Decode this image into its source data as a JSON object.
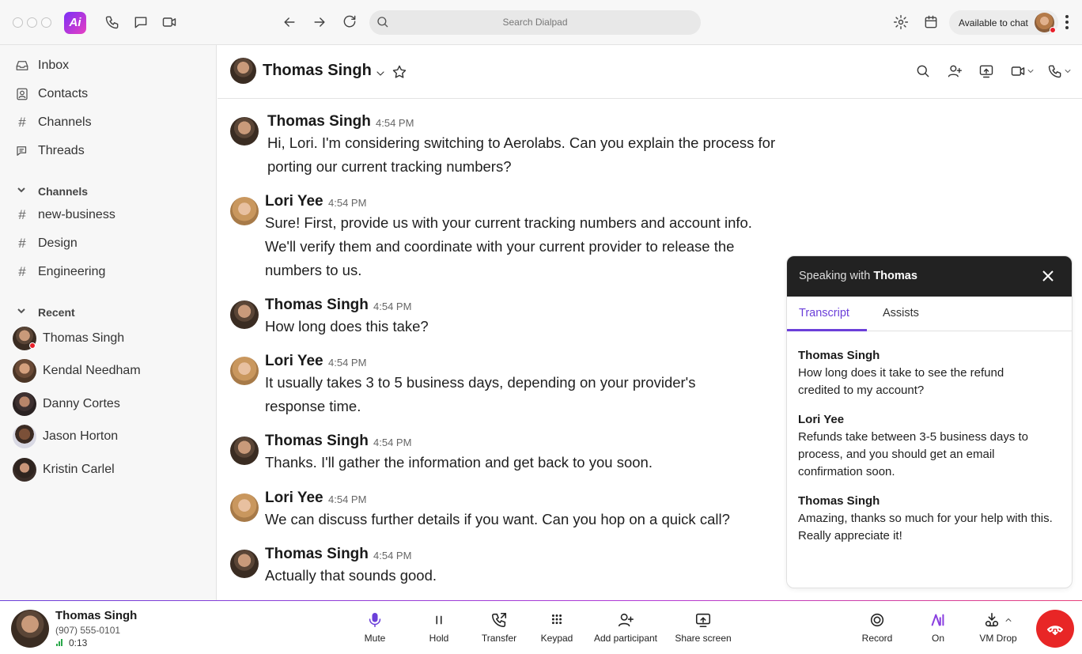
{
  "colors": {
    "accent": "#6b3fd9",
    "danger": "#e82626",
    "online": "#2aa84a"
  },
  "search": {
    "placeholder": "Search Dialpad"
  },
  "availability": {
    "label": "Available to chat"
  },
  "sidebar": {
    "nav": [
      {
        "label": "Inbox",
        "icon": "inbox-icon"
      },
      {
        "label": "Contacts",
        "icon": "contacts-icon"
      },
      {
        "label": "Channels",
        "icon": "hash-icon"
      },
      {
        "label": "Threads",
        "icon": "threads-icon"
      }
    ],
    "channels_header": "Channels",
    "channels": [
      "new-business",
      "Design",
      "Engineering"
    ],
    "recent_header": "Recent",
    "recent": [
      "Thomas Singh",
      "Kendal Needham",
      "Danny Cortes",
      "Jason Horton",
      "Kristin Carlel"
    ]
  },
  "conversation": {
    "title": "Thomas Singh",
    "messages": [
      {
        "author": "Thomas Singh",
        "time": "4:54 PM",
        "text": "Hi, Lori. I'm considering switching to Aerolabs. Can you explain the process for porting our current tracking numbers?"
      },
      {
        "author": "Lori Yee",
        "time": "4:54 PM",
        "text": "Sure! First, provide us with your current tracking numbers and account info. We'll verify them and coordinate with your current provider to release the numbers to us."
      },
      {
        "author": "Thomas Singh",
        "time": "4:54 PM",
        "text": "How long does this take?"
      },
      {
        "author": "Lori Yee",
        "time": "4:54 PM",
        "text": "It usually takes 3 to 5 business days, depending on your provider's response time."
      },
      {
        "author": "Thomas Singh",
        "time": "4:54 PM",
        "text": "Thanks. I'll gather the information and get back to you soon."
      },
      {
        "author": "Lori Yee",
        "time": "4:54 PM",
        "text": "We can discuss further details if you want. Can you hop on a quick call?"
      },
      {
        "author": "Thomas Singh",
        "time": "4:54 PM",
        "text": "Actually that sounds good."
      }
    ]
  },
  "panel": {
    "title_prefix": "Speaking with",
    "title_name": "Thomas",
    "tabs": [
      "Transcript",
      "Assists"
    ],
    "transcript": [
      {
        "speaker": "Thomas Singh",
        "text": "How long does it take to see the refund credited to my account?"
      },
      {
        "speaker": "Lori Yee",
        "text": "Refunds take between 3-5 business days to process, and you should get an email confirmation soon."
      },
      {
        "speaker": "Thomas Singh",
        "text": "Amazing, thanks so much for your help with this. Really appreciate it!"
      }
    ]
  },
  "call": {
    "name": "Thomas Singh",
    "number": "(907) 555-0101",
    "duration": "0:13",
    "controls": [
      "Mute",
      "Hold",
      "Transfer",
      "Keypad",
      "Add participant",
      "Share screen"
    ],
    "right_controls": [
      "Record",
      "On",
      "VM Drop"
    ]
  }
}
